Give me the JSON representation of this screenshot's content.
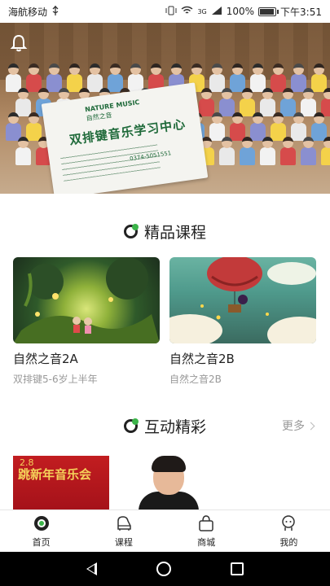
{
  "status_bar": {
    "carrier": "海航移动",
    "network": "3G",
    "battery_text": "100%",
    "battery_level": 1.0,
    "time": "下午3:51"
  },
  "banner": {
    "sign_brand": "NATURE MUSIC",
    "sign_brand_cn": "自然之音",
    "sign_title": "双排键音乐学习中心",
    "sign_phone": "0374-5051551",
    "slide_count": 3,
    "active_slide": 1
  },
  "featured": {
    "title": "精品课程",
    "courses": [
      {
        "name": "自然之音2A",
        "subtitle": "双排键5-6岁上半年"
      },
      {
        "name": "自然之音2B",
        "subtitle": "自然之音2B"
      }
    ]
  },
  "interactive": {
    "title": "互动精彩",
    "more_label": "更多",
    "promo_text": "跳新年音乐会",
    "promo_number": "2.8"
  },
  "tabbar": {
    "items": [
      {
        "label": "首页",
        "icon": "home-icon",
        "active": true
      },
      {
        "label": "课程",
        "icon": "piano-icon",
        "active": false
      },
      {
        "label": "商城",
        "icon": "shopping-bag-icon",
        "active": false
      },
      {
        "label": "我的",
        "icon": "profile-icon",
        "active": false
      }
    ]
  },
  "colors": {
    "accent_green": "#3cb44a",
    "text_primary": "#222222",
    "text_secondary": "#999999"
  }
}
